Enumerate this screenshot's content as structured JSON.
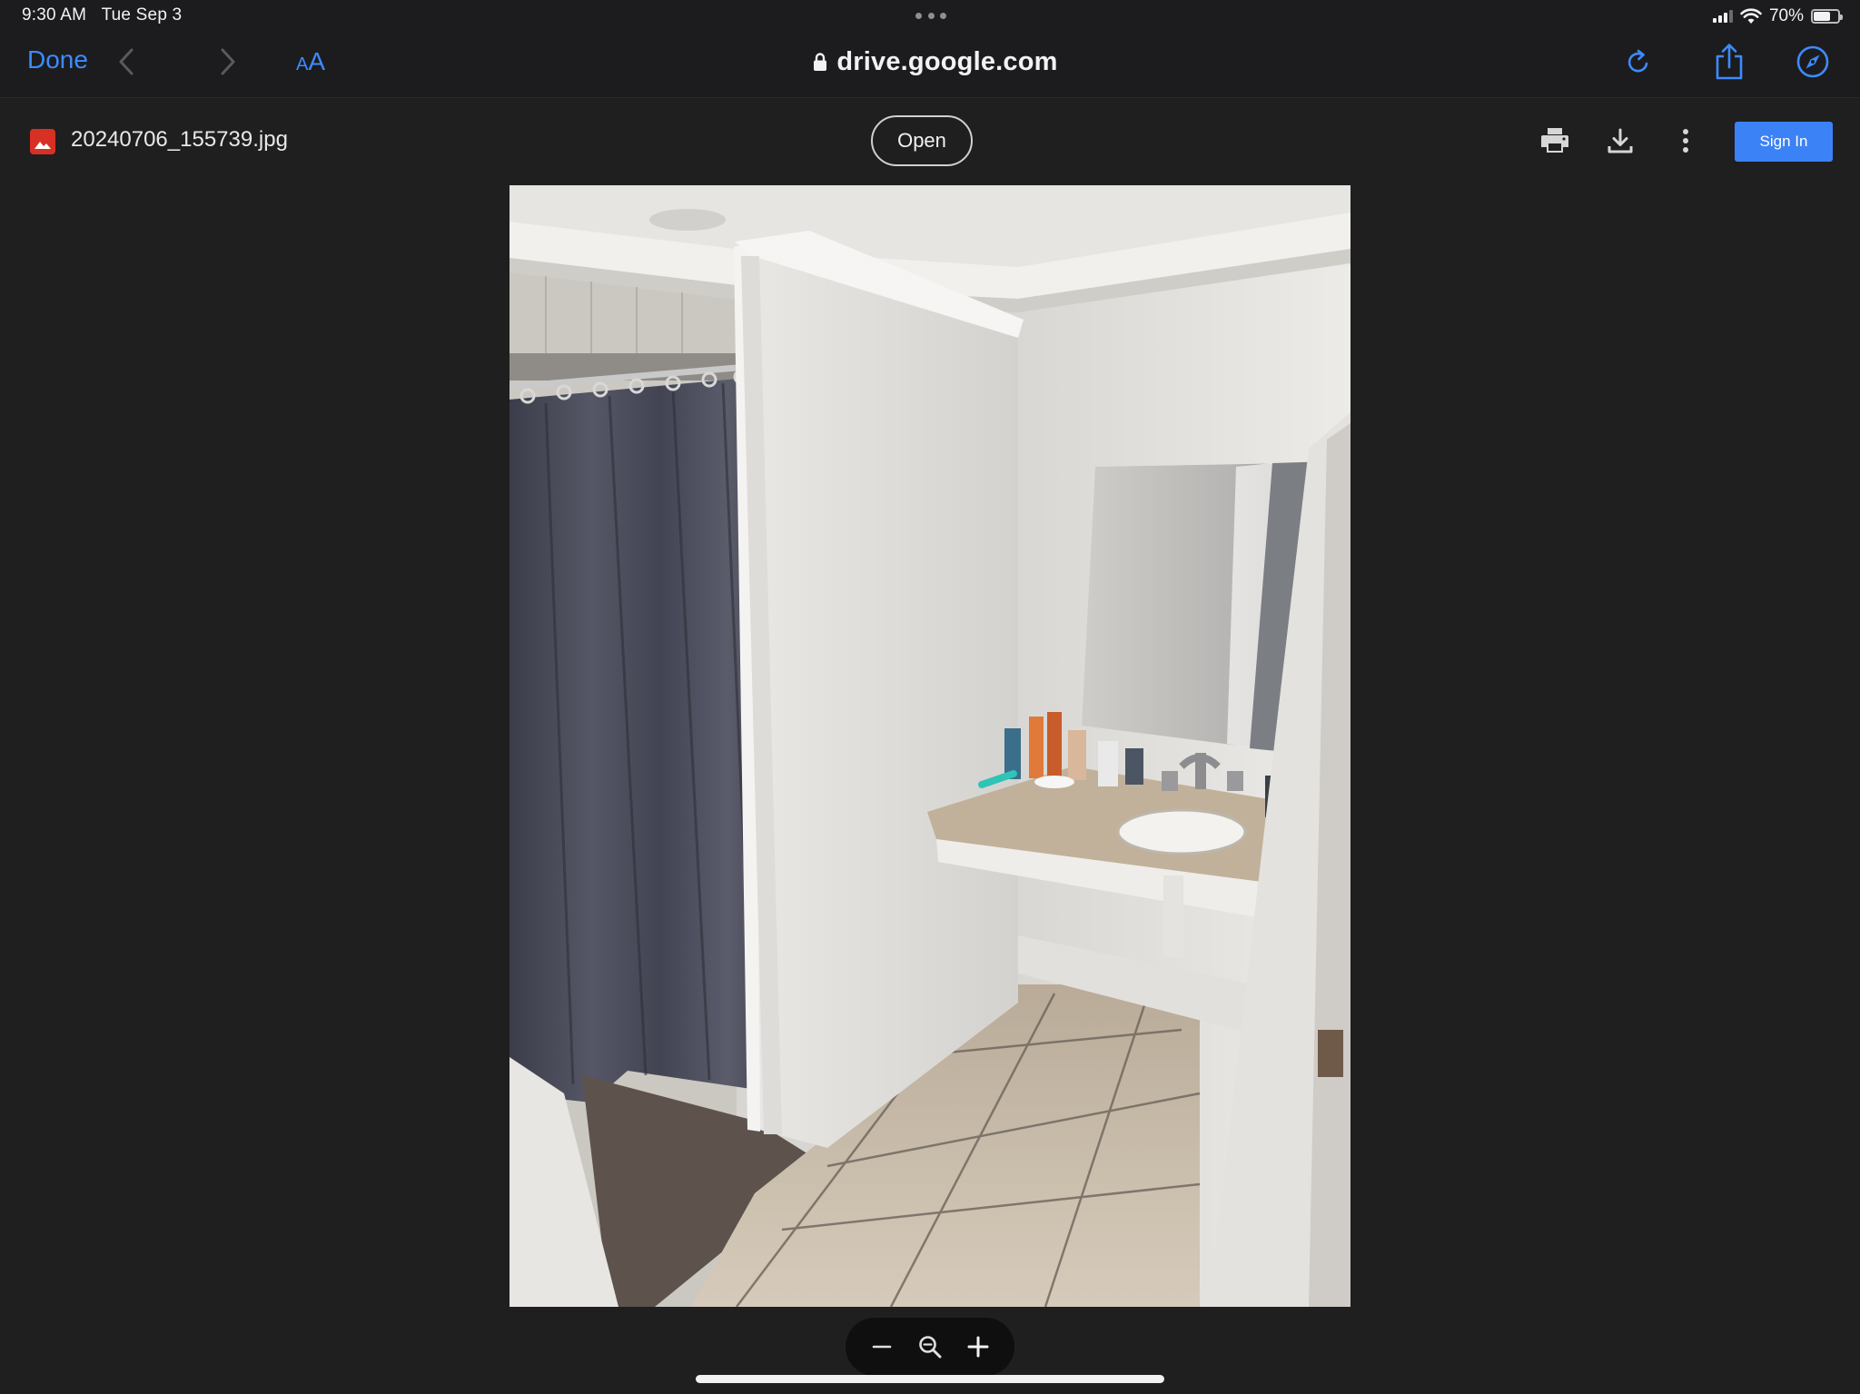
{
  "status_bar": {
    "time": "9:30 AM",
    "date": "Tue Sep 3",
    "battery_percent": "70%",
    "battery_level": 0.7
  },
  "safari": {
    "done_label": "Done",
    "aa_label": "AA",
    "url": "drive.google.com",
    "icons": [
      "lock-icon",
      "reload-icon",
      "share-icon",
      "compass-icon",
      "back-chevron-icon",
      "forward-chevron-icon"
    ]
  },
  "viewer": {
    "file_name": "20240706_155739.jpg",
    "open_label": "Open",
    "sign_in_label": "Sign In",
    "icons": [
      "image-file-icon",
      "print-icon",
      "download-icon",
      "more-vert-icon"
    ]
  },
  "zoom": {
    "icons": [
      "zoom-out-icon",
      "zoom-reset-icon",
      "zoom-in-icon"
    ]
  },
  "colors": {
    "accent": "#3d8bfd",
    "sign_in": "#3b82f6",
    "file_icon": "#d93025",
    "background": "#1f1f1f"
  }
}
